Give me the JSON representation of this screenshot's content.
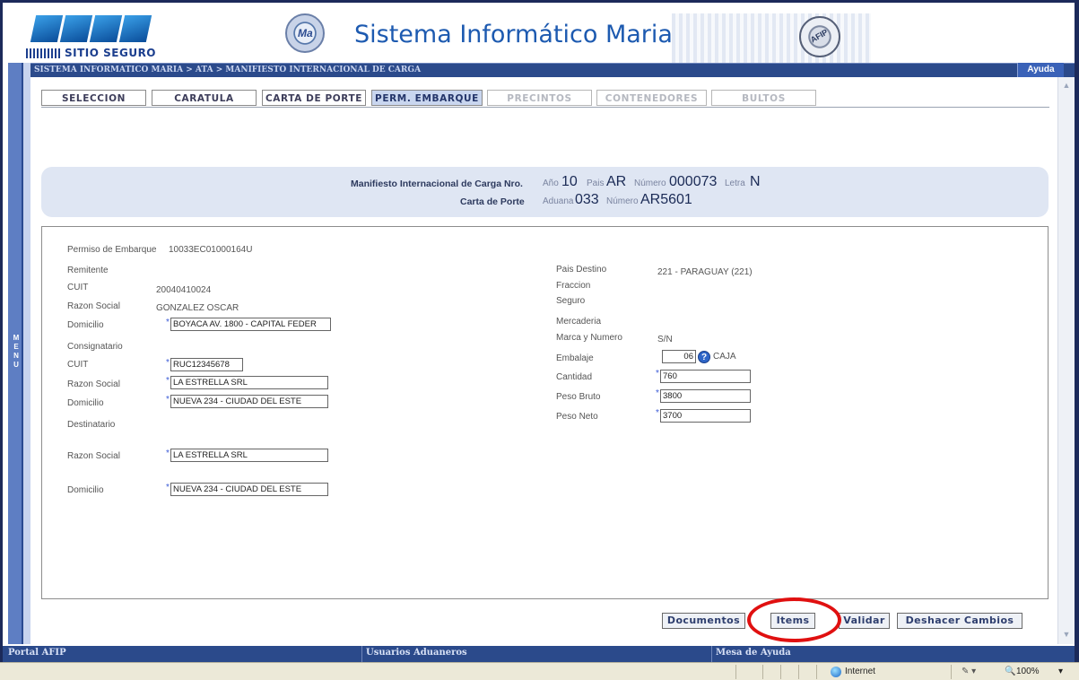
{
  "header": {
    "logo_text": "SITIO SEGURO",
    "app_title": "Sistema Informático Maria",
    "maria_seal_text": "Ma",
    "aduana_seal_text": "AFIP"
  },
  "breadcrumb": "SISTEMA INFORMATICO MARIA > ATA > MANIFIESTO INTERNACIONAL DE CARGA",
  "help_label": "Ayuda",
  "menu_label": "MENU",
  "tabs": [
    {
      "label": "SELECCION",
      "state": "normal"
    },
    {
      "label": "CARATULA",
      "state": "normal"
    },
    {
      "label": "CARTA DE PORTE",
      "state": "normal"
    },
    {
      "label": "PERM. EMBARQUE",
      "state": "active"
    },
    {
      "label": "PRECINTOS",
      "state": "disabled"
    },
    {
      "label": "CONTENEDORES",
      "state": "disabled"
    },
    {
      "label": "BULTOS",
      "state": "disabled"
    }
  ],
  "banner": {
    "manifest_label": "Manifiesto Internacional de Carga Nro.",
    "anio_label": "Año",
    "anio": "10",
    "pais_label": "Pais",
    "pais": "AR",
    "numero_label": "Número",
    "numero": "000073",
    "letra_label": "Letra",
    "letra": "N",
    "carta_label": "Carta de Porte",
    "aduana_label": "Aduana",
    "aduana": "033",
    "carta_numero_label": "Número",
    "carta_numero": "AR5601"
  },
  "form": {
    "permiso_label": "Permiso de Embarque",
    "permiso_value": "10033EC01000164U",
    "remitente_label": "Remitente",
    "rem_cuit_label": "CUIT",
    "rem_cuit_value": "20040410024",
    "rem_razon_label": "Razon Social",
    "rem_razon_value": "GONZALEZ OSCAR",
    "rem_domicilio_label": "Domicilio",
    "rem_domicilio_value": "BOYACA AV. 1800  - CAPITAL FEDER",
    "consignatario_label": "Consignatario",
    "con_cuit_label": "CUIT",
    "con_cuit_value": "RUC12345678",
    "con_razon_label": "Razon Social",
    "con_razon_value": "LA ESTRELLA SRL",
    "con_domicilio_label": "Domicilio",
    "con_domicilio_value": "NUEVA 234 - CIUDAD DEL ESTE",
    "destinatario_label": "Destinatario",
    "des_razon_label": "Razon Social",
    "des_razon_value": "LA ESTRELLA SRL",
    "des_domicilio_label": "Domicilio",
    "des_domicilio_value": "NUEVA 234 - CIUDAD DEL ESTE",
    "pais_destino_label": "Pais Destino",
    "pais_destino_value": "221 - PARAGUAY (221)",
    "fraccion_label": "Fraccion",
    "seguro_label": "Seguro",
    "mercaderia_label": "Mercaderia",
    "marca_label": "Marca y Numero",
    "marca_value": "S/N",
    "embalaje_label": "Embalaje",
    "embalaje_value": "06",
    "embalaje_desc": "CAJA",
    "cantidad_label": "Cantidad",
    "cantidad_value": "760",
    "peso_bruto_label": "Peso Bruto",
    "peso_bruto_value": "3800",
    "peso_neto_label": "Peso Neto",
    "peso_neto_value": "3700",
    "required_mark": "*"
  },
  "buttons": {
    "documentos": "Documentos",
    "items": "Items",
    "validar": "Validar",
    "deshacer": "Deshacer Cambios"
  },
  "footer": {
    "portal": "Portal AFIP",
    "usuarios": "Usuarios Aduaneros",
    "mesa": "Mesa de Ayuda"
  },
  "statusbar": {
    "zone": "Internet",
    "zoom": "100%"
  },
  "colors": {
    "nav_blue": "#2b4a8b",
    "active_tab": "#c9d6ef",
    "banner_bg": "#dfe6f3",
    "highlight": "#e01010",
    "required": "#3b5bd6"
  }
}
